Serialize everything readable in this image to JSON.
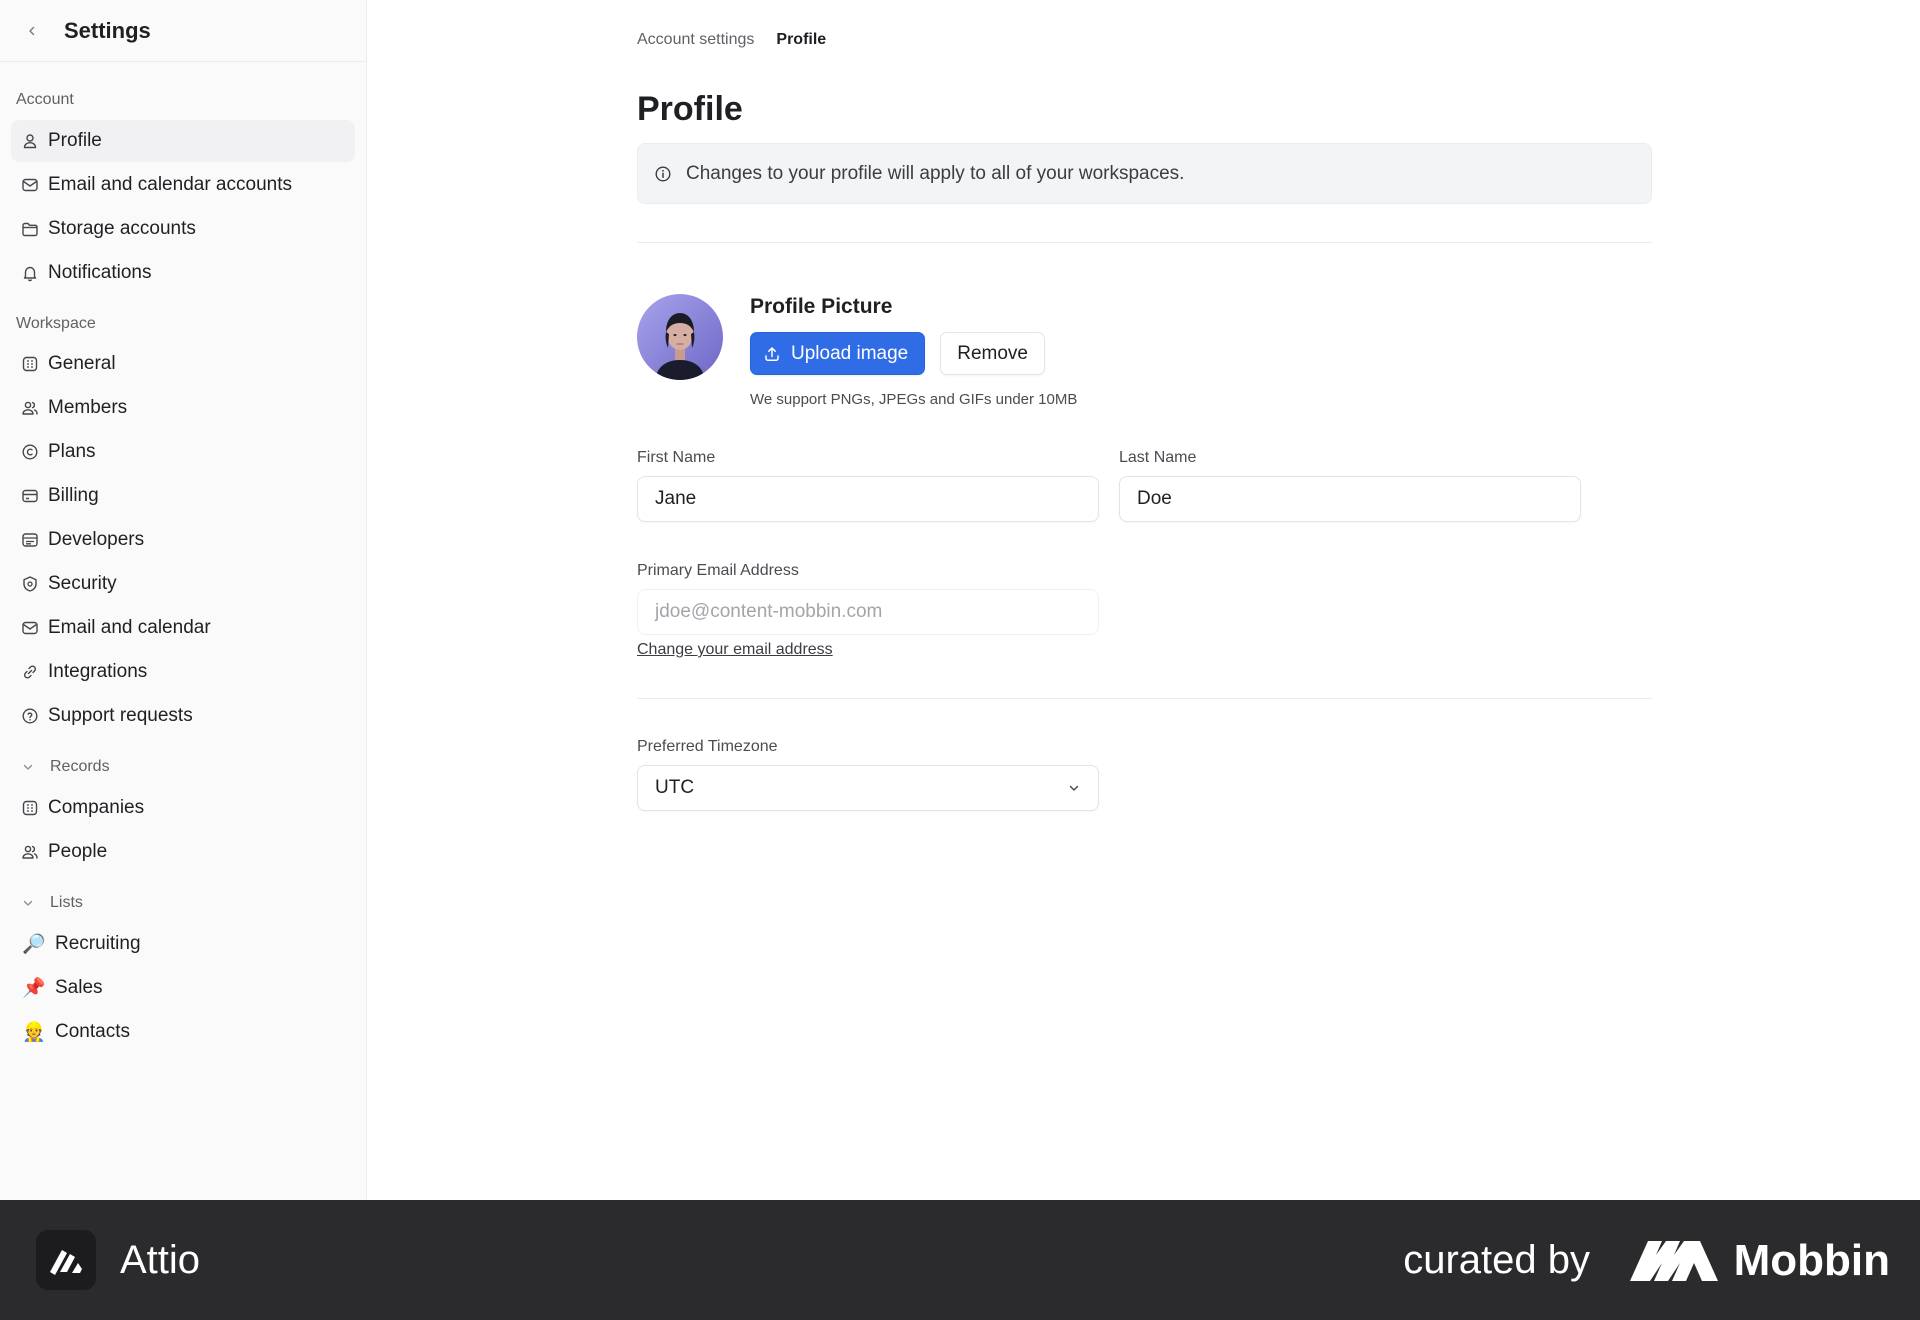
{
  "sidebar": {
    "title": "Settings",
    "account_label": "Account",
    "account_items": [
      {
        "label": "Profile",
        "icon": "user-icon"
      },
      {
        "label": "Email and calendar accounts",
        "icon": "mail-icon"
      },
      {
        "label": "Storage accounts",
        "icon": "folder-icon"
      },
      {
        "label": "Notifications",
        "icon": "bell-icon"
      }
    ],
    "workspace_label": "Workspace",
    "workspace_items": [
      {
        "label": "General",
        "icon": "building-icon"
      },
      {
        "label": "Members",
        "icon": "users-icon"
      },
      {
        "label": "Plans",
        "icon": "plan-icon"
      },
      {
        "label": "Billing",
        "icon": "credit-card-icon"
      },
      {
        "label": "Developers",
        "icon": "code-window-icon"
      },
      {
        "label": "Security",
        "icon": "shield-icon"
      },
      {
        "label": "Email and calendar",
        "icon": "mail-icon"
      },
      {
        "label": "Integrations",
        "icon": "link-icon"
      },
      {
        "label": "Support requests",
        "icon": "help-circle-icon"
      }
    ],
    "records_label": "Records",
    "records_items": [
      {
        "label": "Companies",
        "icon": "building-icon"
      },
      {
        "label": "People",
        "icon": "users-icon"
      }
    ],
    "lists_label": "Lists",
    "lists_items": [
      {
        "label": "Recruiting",
        "emoji": "🔎"
      },
      {
        "label": "Sales",
        "emoji": "📌"
      },
      {
        "label": "Contacts",
        "emoji": "👷"
      }
    ]
  },
  "main": {
    "breadcrumb_parent": "Account settings",
    "breadcrumb_current": "Profile",
    "title": "Profile",
    "info_text": "Changes to your profile will apply to all of your workspaces.",
    "profile_picture_title": "Profile Picture",
    "upload_label": "Upload image",
    "remove_label": "Remove",
    "picture_hint": "We support PNGs, JPEGs and GIFs under 10MB",
    "first_name_label": "First Name",
    "first_name_value": "Jane",
    "last_name_label": "Last Name",
    "last_name_value": "Doe",
    "email_label": "Primary Email Address",
    "email_value": "jdoe@content-mobbin.com",
    "change_email_label": "Change your email address",
    "timezone_label": "Preferred Timezone",
    "timezone_value": "UTC"
  },
  "footer": {
    "app_name": "Attio",
    "curated_by": "curated by",
    "brand": "Mobbin"
  },
  "colors": {
    "primary_button": "#2f6ce5",
    "sidebar_bg": "#fafafa",
    "footer_bg": "#2b2b2d"
  }
}
